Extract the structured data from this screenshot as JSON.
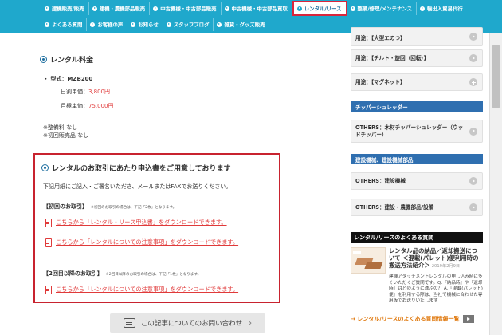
{
  "nav": {
    "row1": [
      "建機販売/販売",
      "建機・農機部品販売",
      "中古機械・中古部品販売",
      "中古機械・中古部品買取",
      "レンタル/リース",
      "整備/修理/メンテナンス",
      "輸出入貿易代行"
    ],
    "row2": [
      "よくある質問",
      "お客様の声",
      "お知らせ",
      "スタッフブログ",
      "雑貨・グッズ販売"
    ],
    "active": "レンタル/リース"
  },
  "main": {
    "rental_fee_title": "レンタル料金",
    "model": "・ 型式：MZB200",
    "daily_label": "日割単価：",
    "daily_price": "3,800円",
    "monthly_label": "月極単価：",
    "monthly_price": "75,000円",
    "note1": "※整備料 なし",
    "note2": "※初回販売品 なし",
    "apply_title": "レンタルのお取引にあたり申込書をご用意しております",
    "apply_desc": "下記用紙にご記入・ご署名いただき、メールまたはFAXでお送りください。",
    "first_label": "【初回のお取引】",
    "first_note": "※初回のお取引の場合は、下記「2枚」となります。",
    "link1": "こちらから「レンタル・リース申込書」をダウンロードできます。",
    "link2": "こちらから「レンタルについての注意事項」をダウンロードできます。",
    "second_label": "【2回目以降のお取引】",
    "second_note": "※2回目以降のお取引の場合は、下記「1枚」となります。",
    "link3": "こちらから「レンタルについての注意事項」をダウンロードできます。",
    "inquiry": "この記事についてのお問い合わせ"
  },
  "sidebar": {
    "top_partial": "用途：【大型エのつ】",
    "items1": [
      "用途：【チルト・旋回（回転）】",
      "用途：【マグネット】"
    ],
    "head1": "チッパーシュレッダー",
    "item_chipper": "OTHERS：木材チッパーシュレッダー（ウッドチッパー）",
    "head2": "建設機械、建設機械部品",
    "item_const": "OTHERS：建設機械",
    "item_parts": "OTHERS：建設・農機部品/設備",
    "faq_head": "レンタル/リースのよくある質問",
    "article_title": "レンタル品の納品／返却搬送について ＜混載(パレット)便利用時の搬送方法紹介＞",
    "article_date": "2019年2月9日",
    "article_body": "建機アタッチメントレンタルの申し込み時に多くいただくご質問です。Q.『納品時』や『返却時』はどのように運ぶの？ A.『混載(パレット)便』を利用する際は、当社で機械に合わせた専用板でお送りいたします",
    "faq_link": "→ レンタル/リースのよくある質問情報一覧"
  }
}
